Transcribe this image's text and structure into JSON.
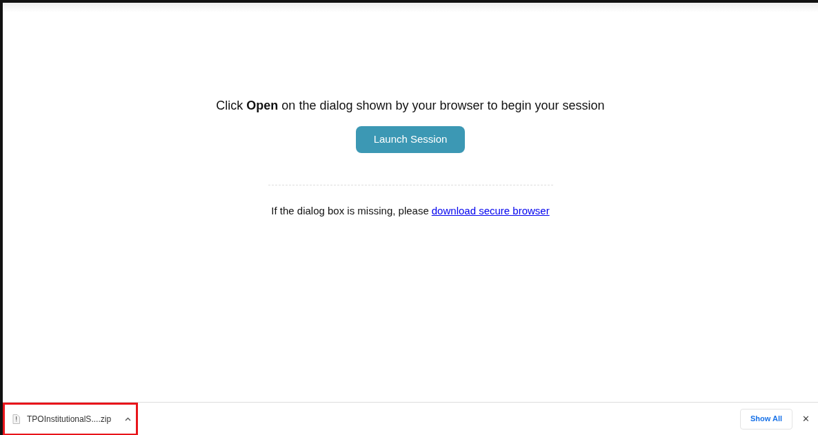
{
  "instruction": "Click **Open** on the dialog shown by your browser to begin your session",
  "launch_button": "Launch Session",
  "fallback": {
    "text": "If the dialog box is missing, please",
    "link": "download secure browser"
  },
  "download_bar": {
    "items": [
      {
        "filename": "TPOInstitutionalS....zip",
        "highlighted": true
      }
    ],
    "show_all": "Show All",
    "close": "✕"
  }
}
